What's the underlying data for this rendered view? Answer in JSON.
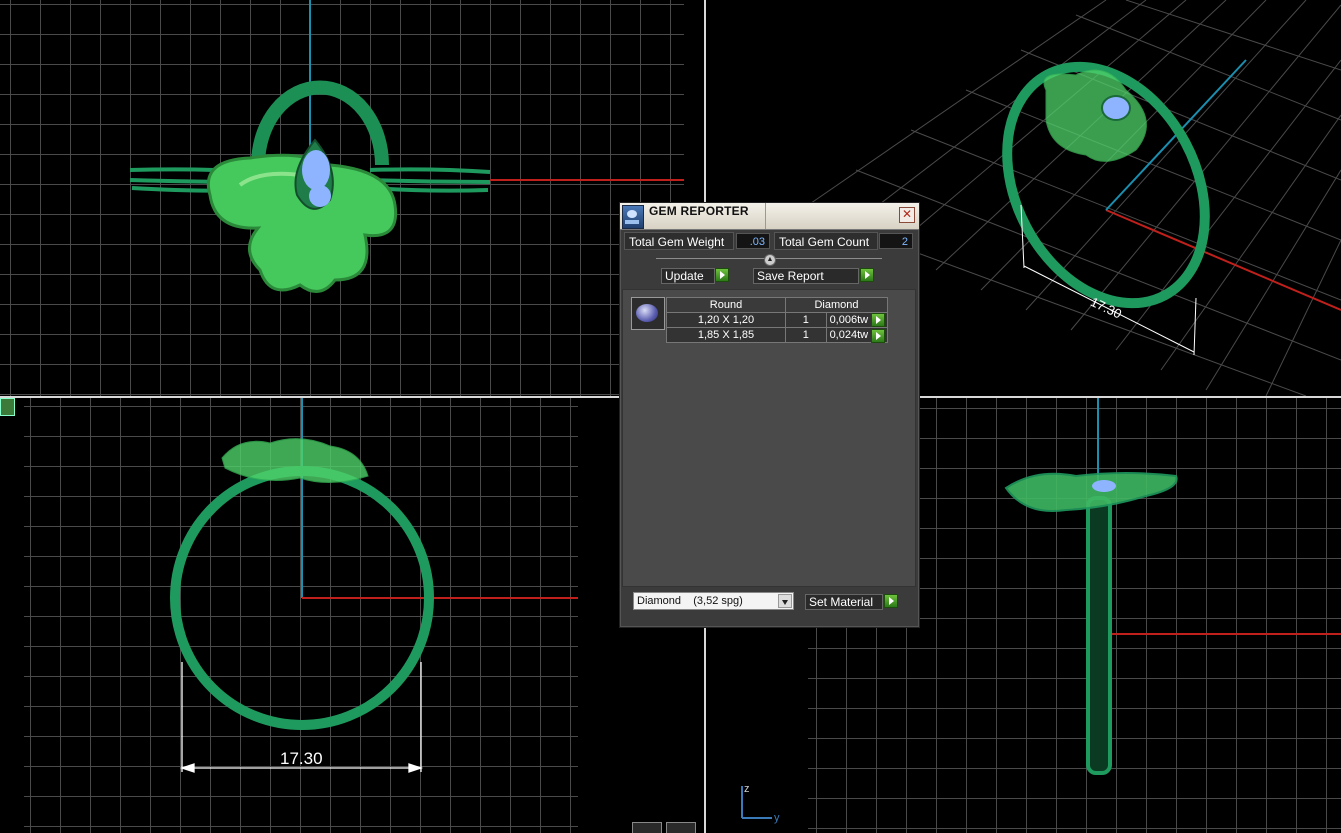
{
  "gem_reporter": {
    "title": "GEM REPORTER",
    "total_gem_weight_label": "Total Gem Weight",
    "total_gem_weight_value": ".03",
    "total_gem_count_label": "Total Gem Count",
    "total_gem_count_value": "2",
    "update_label": "Update",
    "save_report_label": "Save Report",
    "table": {
      "headers": [
        "Round",
        "Diamond"
      ],
      "rows": [
        {
          "size": "1,20 X 1,20",
          "qty": "1",
          "weight": "0,006tw"
        },
        {
          "size": "1,85 X 1,85",
          "qty": "1",
          "weight": "0,024tw"
        }
      ]
    },
    "material_select": "Diamond    (3,52 spg)",
    "set_material_label": "Set Material"
  },
  "viewports": {
    "perspective_dimension": "17.30",
    "front_dimension": "17.30"
  },
  "axis_labels": {
    "z": "z",
    "y": "y"
  },
  "colors": {
    "ring_green": "#1f9a5e",
    "flower_green": "#4fd36a",
    "gem_blue": "#8fb4ff",
    "axis_red": "#c0201c",
    "axis_blue": "#1b8fb0",
    "panel_bg": "#3b3b3b"
  }
}
